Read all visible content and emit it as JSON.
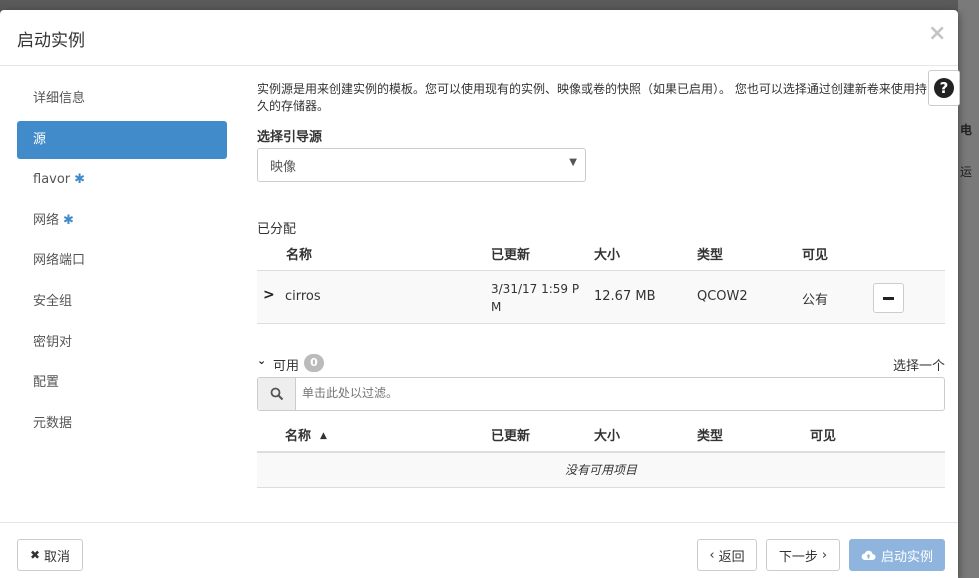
{
  "background": {
    "frag1": "电",
    "frag2": "运"
  },
  "modal": {
    "title": "启动实例",
    "close_glyph": "×"
  },
  "sidebar": {
    "items": [
      {
        "label": "详细信息"
      },
      {
        "label": "源"
      },
      {
        "label": "flavor"
      },
      {
        "label": "网络"
      },
      {
        "label": "网络端口"
      },
      {
        "label": "安全组"
      },
      {
        "label": "密钥对"
      },
      {
        "label": "配置"
      },
      {
        "label": "元数据"
      }
    ],
    "required_mark": "✱"
  },
  "content": {
    "help_text": "实例源是用来创建实例的模板。您可以使用现有的实例、映像或卷的快照（如果已启用）。 您也可以选择通过创建新卷来使用持久的存储器。",
    "help_glyph": "?",
    "boot_source_label": "选择引导源",
    "boot_source_value": "映像",
    "allocated_label": "已分配",
    "columns": {
      "name": "名称",
      "updated": "已更新",
      "size": "大小",
      "type": "类型",
      "visibility": "可见"
    },
    "allocated_rows": [
      {
        "name": "cirros",
        "updated": "3/31/17 1:59 P",
        "updated2": "M",
        "size": "12.67 MB",
        "type": "QCOW2",
        "visibility": "公有"
      }
    ],
    "available_label": "可用",
    "available_count": "0",
    "select_one": "选择一个",
    "filter_placeholder": "单击此处以过滤。",
    "empty_text": "没有可用项目"
  },
  "footer": {
    "cancel": "取消",
    "back": "返回",
    "next": "下一步",
    "launch": "启动实例"
  }
}
